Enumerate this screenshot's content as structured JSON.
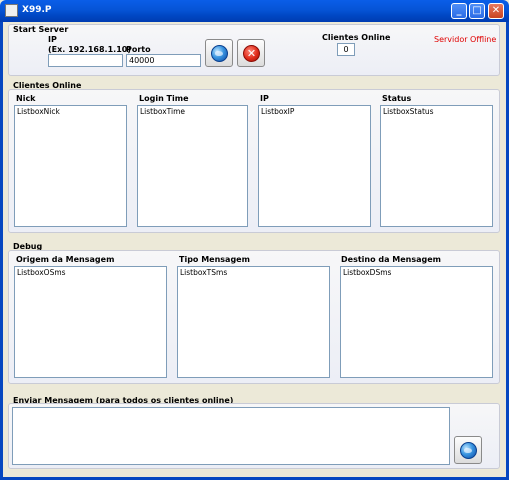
{
  "window": {
    "title": "X99.P",
    "minimize_glyph": "_",
    "maximize_glyph": "□",
    "close_glyph": "✕"
  },
  "start_server": {
    "title": "Start Server",
    "ip_label": "IP",
    "ip_hint": "(Ex. 192.168.1.10)",
    "ip_value": "",
    "port_label": "Porto",
    "port_value": "40000",
    "start_icon": "globe-icon",
    "stop_icon": "stop-icon",
    "stop_glyph": "✕",
    "clients_online_label": "Clientes Online",
    "clients_online_value": "0",
    "status_text": "Servidor Offline",
    "status_color": "#e00000"
  },
  "clients_online": {
    "title": "Clientes Online",
    "columns": [
      {
        "header": "Nick",
        "listbox": "ListboxNick"
      },
      {
        "header": "Login Time",
        "listbox": "ListboxTime"
      },
      {
        "header": "IP",
        "listbox": "ListboxIP"
      },
      {
        "header": "Status",
        "listbox": "ListboxStatus"
      }
    ]
  },
  "debug": {
    "title": "Debug",
    "columns": [
      {
        "header": "Origem da Mensagem",
        "listbox": "ListboxOSms"
      },
      {
        "header": "Tipo Mensagem",
        "listbox": "ListboxTSms"
      },
      {
        "header": "Destino da Mensagem",
        "listbox": "ListboxDSms"
      }
    ]
  },
  "send_message": {
    "title": "Enviar Mensagem (para todos os clientes online)",
    "message_value": "",
    "send_icon": "globe-icon"
  }
}
